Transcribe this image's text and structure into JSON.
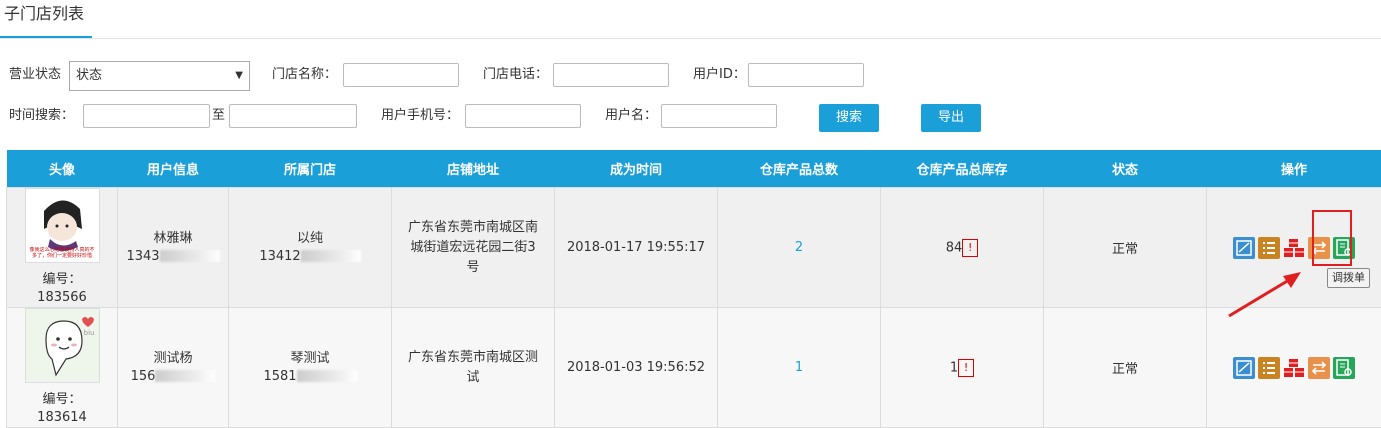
{
  "tab": {
    "title": "子门店列表"
  },
  "filters": {
    "business_status_label": "营业状态",
    "business_status_value": "状态",
    "store_name_label": "门店名称：",
    "store_phone_label": "门店电话：",
    "user_id_label": "用户ID：",
    "time_search_label": "时间搜索：",
    "to_label": "至",
    "user_mobile_label": "用户手机号：",
    "username_label": "用户名：",
    "search_button": "搜索",
    "export_button": "导出"
  },
  "table": {
    "headers": [
      "头像",
      "用户信息",
      "所属门店",
      "店铺地址",
      "成为时间",
      "仓库产品总数",
      "仓库产品总库存",
      "状态",
      "操作"
    ],
    "rows": [
      {
        "id_label": "编号：",
        "id": "183566",
        "user_name": "林雅琳",
        "user_phone_partial": "1343",
        "store_name": "以纯",
        "store_phone_partial": "13412",
        "address": "广东省东莞市南城区南城街道宏远花园二街3号",
        "created": "2018-01-17 19:55:17",
        "product_total": "2",
        "stock_total": "84",
        "warn": "!",
        "status": "正常",
        "avatar_caption": "像我这么心地善良待人真的不多了，你们一定要好好珍惜"
      },
      {
        "id_label": "编号：",
        "id": "183614",
        "user_name": "测试杨",
        "user_phone_partial": "156",
        "store_name": "琴测试",
        "store_phone_partial": "1581",
        "address": "广东省东莞市南城区测试",
        "created": "2018-01-03 19:56:52",
        "product_total": "1",
        "stock_total": "1",
        "warn": "!",
        "status": "正常",
        "avatar_caption": "biu"
      }
    ]
  },
  "tooltip": {
    "text": "调拨单"
  },
  "colors": {
    "accent": "#1a9fd9",
    "highlight": "#e02020"
  }
}
